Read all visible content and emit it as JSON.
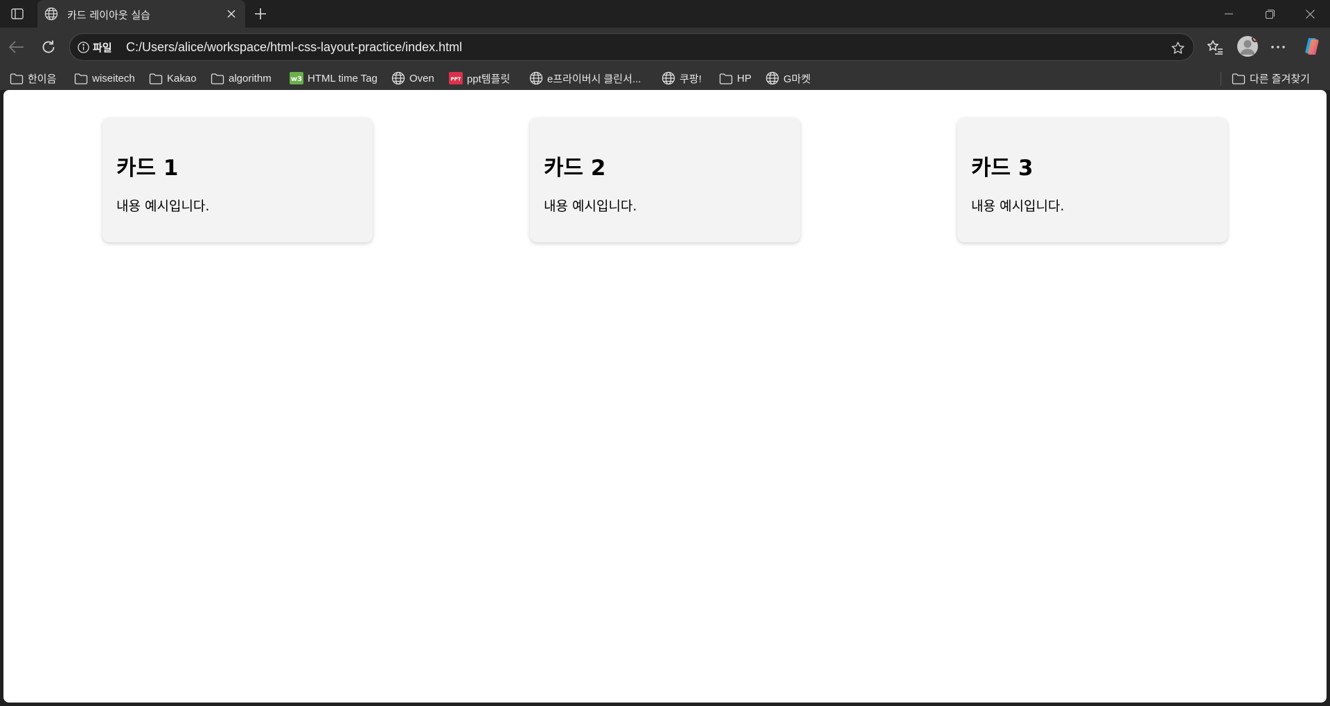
{
  "tab": {
    "title": "카드 레이아웃 실습"
  },
  "address_bar": {
    "chip": "파일",
    "url": "C:/Users/alice/workspace/html-css-layout-practice/index.html"
  },
  "bookmarks": [
    {
      "label": "한이음",
      "icon": "folder-icon"
    },
    {
      "label": "wiseitech",
      "icon": "folder-icon"
    },
    {
      "label": "Kakao",
      "icon": "folder-icon"
    },
    {
      "label": "algorithm",
      "icon": "folder-icon"
    },
    {
      "label": "HTML time Tag",
      "icon": "w3-favicon"
    },
    {
      "label": "Oven",
      "icon": "globe-icon"
    },
    {
      "label": "ppt템플릿",
      "icon": "ppt-favicon"
    },
    {
      "label": "e프라이버시 클린서...",
      "icon": "globe-icon"
    },
    {
      "label": "쿠팡!",
      "icon": "globe-icon"
    },
    {
      "label": "HP",
      "icon": "folder-icon"
    },
    {
      "label": "G마켓",
      "icon": "globe-icon"
    }
  ],
  "other_bookmarks": {
    "label": "다른 즐겨찾기",
    "icon": "folder-icon"
  },
  "page": {
    "cards": [
      {
        "title": "카드 1",
        "body": "내용 예시입니다."
      },
      {
        "title": "카드 2",
        "body": "내용 예시입니다."
      },
      {
        "title": "카드 3",
        "body": "내용 예시입니다."
      }
    ]
  },
  "colors": {
    "chrome_dark": "#202020",
    "toolbar": "#333333",
    "card_bg": "#f3f3f3",
    "page_bg": "#ffffff"
  }
}
